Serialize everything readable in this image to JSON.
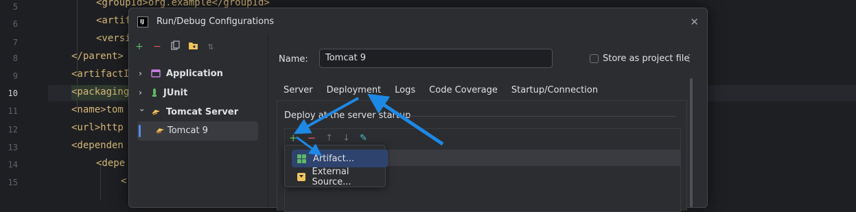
{
  "editor": {
    "line_numbers": [
      "5",
      "6",
      "7",
      "8",
      "9",
      "10",
      "11",
      "12",
      "13",
      "14",
      "15"
    ],
    "active_line": "10",
    "code_lines": [
      {
        "indent": "        ",
        "text": "<groupId>org.example</groupId>"
      },
      {
        "indent": "        ",
        "text": "<artifactId>"
      },
      {
        "indent": "        ",
        "text": "<version>"
      },
      {
        "indent": "",
        "text": "</parent>"
      },
      {
        "indent": "",
        "text": "<artifactId>"
      },
      {
        "indent": "",
        "text": "<packaging>"
      },
      {
        "indent": "",
        "text": "<name>tom"
      },
      {
        "indent": "",
        "text": "<url>http"
      },
      {
        "indent": "",
        "text": "<dependen"
      },
      {
        "indent": "        ",
        "text": "<depe"
      },
      {
        "indent": "            ",
        "text": "<"
      }
    ]
  },
  "dialog": {
    "title": "Run/Debug Configurations",
    "app_icon_text": "IJ",
    "toolbar_icons": [
      "add-icon",
      "remove-icon",
      "copy-icon",
      "folder-icon",
      "sort-icon"
    ],
    "tree": {
      "items": [
        {
          "label": "Application",
          "expanded": false
        },
        {
          "label": "JUnit",
          "expanded": false
        },
        {
          "label": "Tomcat Server",
          "expanded": true
        }
      ],
      "selected_child": "Tomcat 9"
    },
    "form": {
      "name_label": "Name:",
      "name_value": "Tomcat 9",
      "store_label": "Store as project file",
      "store_checked": false
    },
    "tabs": [
      "Server",
      "Deployment",
      "Logs",
      "Code Coverage",
      "Startup/Connection"
    ],
    "active_tab": "Deployment",
    "deploy_label": "Deploy at the server startup",
    "popup": {
      "items": [
        {
          "label": "Artifact...",
          "icon": "artifact-icon",
          "selected": true
        },
        {
          "label": "External Source...",
          "icon": "external-source-icon",
          "selected": false
        }
      ]
    }
  },
  "colors": {
    "accent": "#548af7",
    "arrow": "#1e88e5",
    "add_green": "#5fb865",
    "remove_red": "#e55765"
  }
}
